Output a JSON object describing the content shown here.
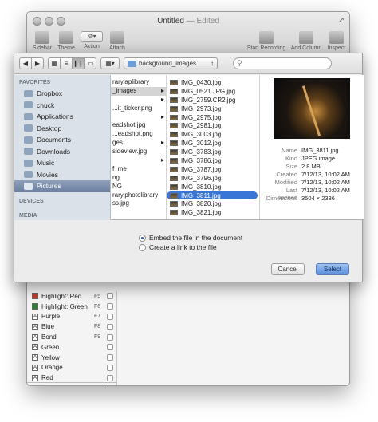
{
  "window": {
    "title": "Untitled",
    "edited": "— Edited"
  },
  "toolbar": {
    "items": [
      "Sidebar",
      "Theme",
      "Action",
      "Attach",
      "Start Recording",
      "Add Column",
      "Inspect"
    ]
  },
  "sheet": {
    "path": "background_images",
    "search_placeholder": "",
    "sidebar": {
      "favorites_header": "FAVORITES",
      "favorites": [
        {
          "label": "Dropbox",
          "icon": "folder-icon"
        },
        {
          "label": "chuck",
          "icon": "home-icon"
        },
        {
          "label": "Applications",
          "icon": "applications-icon"
        },
        {
          "label": "Desktop",
          "icon": "desktop-icon"
        },
        {
          "label": "Documents",
          "icon": "documents-icon"
        },
        {
          "label": "Downloads",
          "icon": "downloads-icon"
        },
        {
          "label": "Music",
          "icon": "music-icon"
        },
        {
          "label": "Movies",
          "icon": "movies-icon"
        },
        {
          "label": "Pictures",
          "icon": "pictures-icon"
        }
      ],
      "devices_header": "DEVICES",
      "media_header": "MEDIA"
    },
    "column1": [
      "rary.aplibrary",
      "_images",
      "",
      "...it_ticker.png",
      "",
      "eadshot.jpg",
      "...eadshot.png",
      "ges",
      "sideview.jpg",
      "",
      "f_me",
      "ng",
      "NG",
      "rary.photolibrary",
      "ss.jpg"
    ],
    "column2": [
      "IMG_0430.jpg",
      "IMG_0521.JPG.jpg",
      "IMG_2759.CR2.jpg",
      "IMG_2973.jpg",
      "IMG_2975.jpg",
      "IMG_2981.jpg",
      "IMG_3003.jpg",
      "IMG_3012.jpg",
      "IMG_3783.jpg",
      "IMG_3786.jpg",
      "IMG_3787.jpg",
      "IMG_3796.jpg",
      "IMG_3810.jpg",
      "IMG_3811.jpg",
      "IMG_3820.jpg",
      "IMG_3821.jpg"
    ],
    "selected_file": "IMG_3811.jpg",
    "info": [
      {
        "k": "Name",
        "v": "IMG_3811.jpg"
      },
      {
        "k": "Kind",
        "v": "JPEG image"
      },
      {
        "k": "Size",
        "v": "2.8 MB"
      },
      {
        "k": "Created",
        "v": "7/12/13, 10:02 AM"
      },
      {
        "k": "Modified",
        "v": "7/12/13, 10:02 AM"
      },
      {
        "k": "Last opened",
        "v": "7/12/13, 10:02 AM"
      },
      {
        "k": "Dimensions",
        "v": "3504 × 2336"
      }
    ],
    "option_embed": "Embed the file in the document",
    "option_link": "Create a link to the file",
    "cancel": "Cancel",
    "select": "Select"
  },
  "styles": [
    {
      "label": "Highlight: Red",
      "key": "F5",
      "swatch": "#c0392b",
      "letter": ""
    },
    {
      "label": "Highlight: Green",
      "key": "F6",
      "swatch": "#2e7d32",
      "letter": ""
    },
    {
      "label": "Purple",
      "key": "F7",
      "swatch": "#ffffff",
      "letter": "A"
    },
    {
      "label": "Blue",
      "key": "F8",
      "swatch": "#ffffff",
      "letter": "A"
    },
    {
      "label": "Bondi",
      "key": "F9",
      "swatch": "#ffffff",
      "letter": "A"
    },
    {
      "label": "Green",
      "key": "",
      "swatch": "#ffffff",
      "letter": "A"
    },
    {
      "label": "Yellow",
      "key": "",
      "swatch": "#ffffff",
      "letter": "A"
    },
    {
      "label": "Orange",
      "key": "",
      "swatch": "#ffffff",
      "letter": "A"
    },
    {
      "label": "Red",
      "key": "",
      "swatch": "#ffffff",
      "letter": "A"
    }
  ],
  "footer": {
    "add": "+",
    "gear": "⚙▾"
  }
}
